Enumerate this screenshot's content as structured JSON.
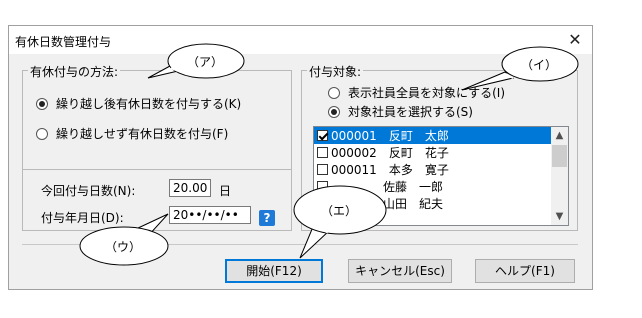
{
  "window": {
    "title": "有休日数管理付与",
    "close_glyph": "✕"
  },
  "method_group": {
    "legend": "有休付与の方法:",
    "options": [
      {
        "label": "繰り越し後有休日数を付与する(K)",
        "checked": true
      },
      {
        "label": "繰り越しせず有休日数を付与(F)",
        "checked": false
      }
    ]
  },
  "grant_group": {
    "days_label": "今回付与日数(N):",
    "days_value": "20.00",
    "days_unit": "日",
    "date_label": "付与年月日(D):",
    "date_value": "20••/••/••",
    "help_icon_text": "?"
  },
  "target_group": {
    "legend": "付与対象:",
    "options": [
      {
        "label": "表示社員全員を対象にする(I)",
        "checked": false
      },
      {
        "label": "対象社員を選択する(S)",
        "checked": true
      }
    ],
    "employees": [
      {
        "code": "000001",
        "name": "反町　太郎",
        "checked": true,
        "selected": true
      },
      {
        "code": "000002",
        "name": "反町　花子",
        "checked": false,
        "selected": false
      },
      {
        "code": "000011",
        "name": "本多　寛子",
        "checked": false,
        "selected": false
      },
      {
        "code": "",
        "name": "佐藤　一郎",
        "checked": false,
        "selected": false
      },
      {
        "code": "",
        "name": "山田　紀夫",
        "checked": false,
        "selected": false
      }
    ]
  },
  "buttons": {
    "start": "開始(F12)",
    "cancel": "キャンセル(Esc)",
    "help": "ヘルプ(F1)"
  },
  "callouts": {
    "a": "（ア）",
    "i": "（イ）",
    "u": "（ウ）",
    "e": "（エ）"
  }
}
